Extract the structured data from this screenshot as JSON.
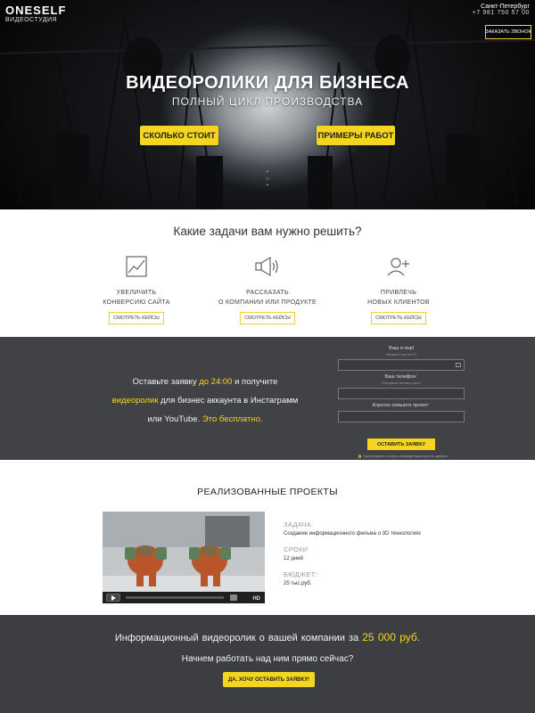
{
  "header": {
    "logo_main": "ONESELF",
    "logo_sub": "ВИДЕОСТУДИЯ",
    "city": "Санкт-Петербург",
    "phone": "+7 981 750 57 00",
    "callback_label": "ЗАКАЗАТЬ ЗВОНОК"
  },
  "hero": {
    "title": "ВИДЕОРОЛИКИ ДЛЯ БИЗНЕСА",
    "subtitle": "ПОЛНЫЙ ЦИКЛ ПРОИЗВОДСТВА",
    "price_button": "СКОЛЬКО СТОИТ",
    "works_button": "ПРИМЕРЫ РАБОТ"
  },
  "tasks": {
    "title": "Какие задачи вам нужно решить?",
    "items": [
      {
        "icon": "chart-icon",
        "label": "УВЕЛИЧИТЬ\nКОНВЕРСИЮ САЙТА",
        "button": "СМОТРЕТЬ КЕЙСЫ"
      },
      {
        "icon": "megaphone-icon",
        "label": "РАССКАЗАТЬ\nО КОМПАНИИ ИЛИ ПРОДУКТЕ",
        "button": "СМОТРЕТЬ КЕЙСЫ"
      },
      {
        "icon": "add-user-icon",
        "label": "ПРИВЛЕЧЬ\nНОВЫХ КЛИЕНТОВ",
        "button": "СМОТРЕТЬ КЕЙСЫ"
      }
    ]
  },
  "request": {
    "text_1": "Оставьте заявку",
    "deadline": "до 24:00",
    "text_2": "и получите",
    "product": "видеоролик",
    "text_3": "для бизнес аккаунта в Инстаграмм",
    "text_4": "или YouTube.",
    "free": "Это бесплатно.",
    "email_label": "Ваш e-mail",
    "email_hint": "Вводите как на БЗ",
    "phone_label": "Ваш телефон",
    "phone_hint": "Обещаем звонить рано",
    "project_label": "Коротко опишите проект",
    "submit": "ОСТАВИТЬ ЗАЯВКУ",
    "privacy": "Гарантируем полную конфиденциальность данных"
  },
  "projects": {
    "title": "РЕАЛИЗОВАННЫЕ ПРОЕКТЫ",
    "task_label": "ЗАДАЧА",
    "task_value": "Создание информационного фильма о 3D технологиях",
    "terms_label": "СРОКИ",
    "terms_value": "12 дней",
    "budget_label": "БЮДЖЕТ:",
    "budget_value": "25 тыс.руб.",
    "video_hd": "HD"
  },
  "cta": {
    "text_1": "Информационный видеоролик о вашей компании за",
    "price": "25 000 руб.",
    "text_2": "Начнем работать над ним прямо сейчас?",
    "button": "ДА, ХОЧУ ОСТАВИТЬ ЗАЯВКУ!"
  },
  "colors": {
    "accent": "#f6d51f",
    "dark_band": "#414246",
    "cta_band": "#3d3e42"
  }
}
